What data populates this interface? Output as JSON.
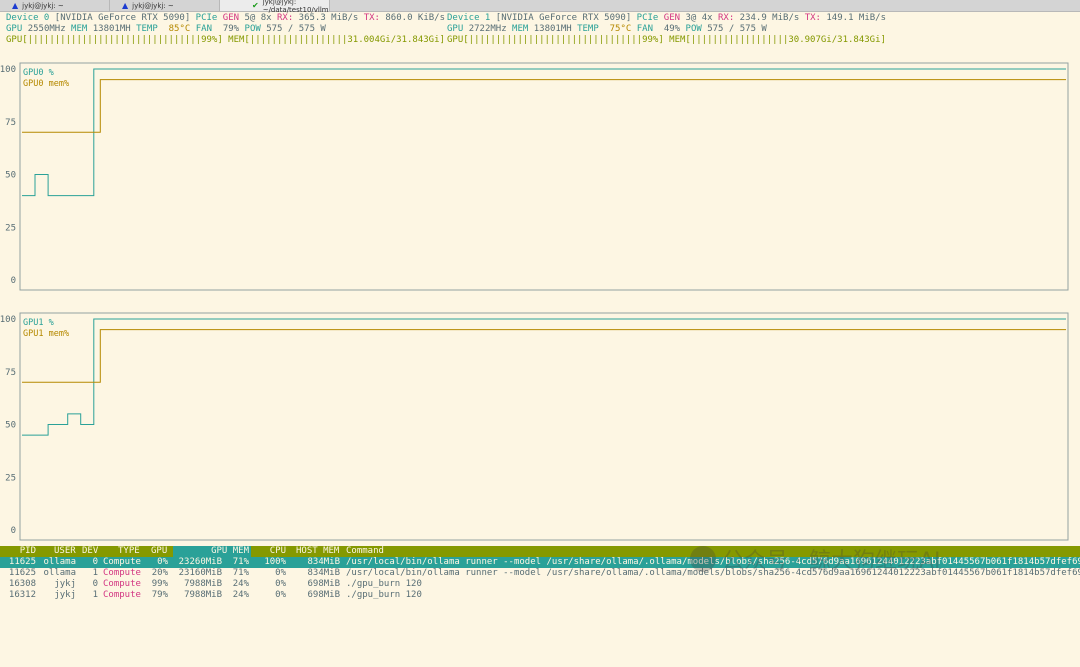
{
  "tabs": [
    {
      "label": "jykj@jykj: ~",
      "icon": "warning-icon",
      "active": false
    },
    {
      "label": "jykj@jykj: ~",
      "icon": "warning-icon",
      "active": false
    },
    {
      "label": "jykj@jykj: ~/data/test10/vllm",
      "icon": "check-icon",
      "active": true
    }
  ],
  "devices": [
    {
      "label": "Device 0",
      "name": "[NVIDIA GeForce RTX 5090]",
      "pcie_label": "PCIe",
      "gen_label": "GEN",
      "gen_value": "5@ 8x",
      "rx_label": "RX:",
      "rx_value": "365.3 MiB/s",
      "tx_label": "TX:",
      "tx_value": "860.0 KiB/s",
      "gpu_label": "GPU",
      "clock": "2550MHz",
      "mem_label": "MEM",
      "mem_clock": "13801MH",
      "temp_label": "TEMP",
      "temp": "85°C",
      "fan_label": "FAN",
      "fan": "79%",
      "pow_label": "POW",
      "pow": "575 / 575 W",
      "util_bar": "GPU[||||||||||||||||||||||||||||||||99%]",
      "mem_bar": "MEM[||||||||||||||||||31.004Gi/31.843Gi]"
    },
    {
      "label": "Device 1",
      "name": "[NVIDIA GeForce RTX 5090]",
      "pcie_label": "PCIe",
      "gen_label": "GEN",
      "gen_value": "3@ 4x",
      "rx_label": "RX:",
      "rx_value": "234.9 MiB/s",
      "tx_label": "TX:",
      "tx_value": "149.1 MiB/s",
      "gpu_label": "GPU",
      "clock": "2722MHz",
      "mem_label": "MEM",
      "mem_clock": "13801MH",
      "temp_label": "TEMP",
      "temp": "75°C",
      "fan_label": "FAN",
      "fan": "49%",
      "pow_label": "POW",
      "pow": "575 / 575 W",
      "util_bar": "GPU[||||||||||||||||||||||||||||||||99%]",
      "mem_bar": "MEM[||||||||||||||||||30.907Gi/31.843Gi]"
    }
  ],
  "chart_data": [
    {
      "type": "line",
      "ylim": [
        0,
        100
      ],
      "yticks": [
        100,
        75,
        50,
        25,
        0
      ],
      "x": [
        0,
        1,
        2,
        3,
        4,
        5,
        6,
        7,
        8,
        9,
        10,
        11,
        12,
        13,
        14,
        15,
        16,
        17,
        18,
        19,
        20,
        21,
        22,
        23,
        24,
        25,
        26,
        27,
        28,
        29,
        30,
        31,
        32,
        33,
        34,
        35,
        36,
        37,
        38,
        39,
        40,
        41,
        42,
        43,
        44,
        45,
        46,
        47,
        48,
        49,
        50,
        51,
        52,
        53,
        54,
        55,
        56,
        57,
        58,
        59,
        60,
        61,
        62,
        63,
        64,
        65,
        66,
        67,
        68,
        69,
        70,
        71,
        72,
        73,
        74,
        75,
        76,
        77,
        78,
        79,
        80,
        81,
        82,
        83,
        84,
        85,
        86,
        87,
        88,
        89,
        90,
        91,
        92,
        93,
        94,
        95,
        96,
        97,
        98,
        99,
        100,
        101,
        102,
        103,
        104,
        105,
        106,
        107,
        108,
        109,
        110,
        111,
        112,
        113,
        114,
        115,
        116,
        117,
        118,
        119,
        120,
        121,
        122,
        123,
        124,
        125,
        126,
        127,
        128,
        129,
        130,
        131,
        132,
        133,
        134,
        135,
        136,
        137,
        138,
        139,
        140,
        141,
        142,
        143,
        144,
        145,
        146,
        147,
        148,
        149,
        150,
        151,
        152,
        153,
        154,
        155,
        156,
        157,
        158,
        159
      ],
      "series": [
        {
          "name": "GPU0 %",
          "color": "#2aa198",
          "values": [
            40,
            40,
            50,
            50,
            40,
            40,
            40,
            40,
            40,
            40,
            40,
            100,
            100,
            100,
            100,
            100,
            100,
            100,
            100,
            100,
            100,
            100,
            100,
            100,
            100,
            100,
            100,
            100,
            100,
            100,
            100,
            100,
            100,
            100,
            100,
            100,
            100,
            100,
            100,
            100,
            100,
            100,
            100,
            100,
            100,
            100,
            100,
            100,
            100,
            100,
            100,
            100,
            100,
            100,
            100,
            100,
            100,
            100,
            100,
            100,
            100,
            100,
            100,
            100,
            100,
            100,
            100,
            100,
            100,
            100,
            100,
            100,
            100,
            100,
            100,
            100,
            100,
            100,
            100,
            100,
            100,
            100,
            100,
            100,
            100,
            100,
            100,
            100,
            100,
            100,
            100,
            100,
            100,
            100,
            100,
            100,
            100,
            100,
            100,
            100,
            100,
            100,
            100,
            100,
            100,
            100,
            100,
            100,
            100,
            100,
            100,
            100,
            100,
            100,
            100,
            100,
            100,
            100,
            100,
            100,
            100,
            100,
            100,
            100,
            100,
            100,
            100,
            100,
            100,
            100,
            100,
            100,
            100,
            100,
            100,
            100,
            100,
            100,
            100,
            100,
            100,
            100,
            100,
            100,
            100,
            100,
            100,
            100,
            100,
            100,
            100,
            100,
            100,
            100,
            100,
            100,
            100,
            100,
            100,
            100
          ]
        },
        {
          "name": "GPU0 mem%",
          "color": "#b58900",
          "values": [
            70,
            70,
            70,
            70,
            70,
            70,
            70,
            70,
            70,
            70,
            70,
            70,
            95,
            95,
            95,
            95,
            95,
            95,
            95,
            95,
            95,
            95,
            95,
            95,
            95,
            95,
            95,
            95,
            95,
            95,
            95,
            95,
            95,
            95,
            95,
            95,
            95,
            95,
            95,
            95,
            95,
            95,
            95,
            95,
            95,
            95,
            95,
            95,
            95,
            95,
            95,
            95,
            95,
            95,
            95,
            95,
            95,
            95,
            95,
            95,
            95,
            95,
            95,
            95,
            95,
            95,
            95,
            95,
            95,
            95,
            95,
            95,
            95,
            95,
            95,
            95,
            95,
            95,
            95,
            95,
            95,
            95,
            95,
            95,
            95,
            95,
            95,
            95,
            95,
            95,
            95,
            95,
            95,
            95,
            95,
            95,
            95,
            95,
            95,
            95,
            95,
            95,
            95,
            95,
            95,
            95,
            95,
            95,
            95,
            95,
            95,
            95,
            95,
            95,
            95,
            95,
            95,
            95,
            95,
            95,
            95,
            95,
            95,
            95,
            95,
            95,
            95,
            95,
            95,
            95,
            95,
            95,
            95,
            95,
            95,
            95,
            95,
            95,
            95,
            95,
            95,
            95,
            95,
            95,
            95,
            95,
            95,
            95,
            95,
            95,
            95,
            95,
            95,
            95,
            95,
            95,
            95,
            95,
            95,
            95
          ]
        }
      ]
    },
    {
      "type": "line",
      "ylim": [
        0,
        100
      ],
      "yticks": [
        100,
        75,
        50,
        25,
        0
      ],
      "x": [
        0,
        1,
        2,
        3,
        4,
        5,
        6,
        7,
        8,
        9,
        10,
        11,
        12,
        13,
        14,
        15,
        16,
        17,
        18,
        19,
        20,
        21,
        22,
        23,
        24,
        25,
        26,
        27,
        28,
        29,
        30,
        31,
        32,
        33,
        34,
        35,
        36,
        37,
        38,
        39,
        40,
        41,
        42,
        43,
        44,
        45,
        46,
        47,
        48,
        49,
        50,
        51,
        52,
        53,
        54,
        55,
        56,
        57,
        58,
        59,
        60,
        61,
        62,
        63,
        64,
        65,
        66,
        67,
        68,
        69,
        70,
        71,
        72,
        73,
        74,
        75,
        76,
        77,
        78,
        79,
        80,
        81,
        82,
        83,
        84,
        85,
        86,
        87,
        88,
        89,
        90,
        91,
        92,
        93,
        94,
        95,
        96,
        97,
        98,
        99,
        100,
        101,
        102,
        103,
        104,
        105,
        106,
        107,
        108,
        109,
        110,
        111,
        112,
        113,
        114,
        115,
        116,
        117,
        118,
        119,
        120,
        121,
        122,
        123,
        124,
        125,
        126,
        127,
        128,
        129,
        130,
        131,
        132,
        133,
        134,
        135,
        136,
        137,
        138,
        139,
        140,
        141,
        142,
        143,
        144,
        145,
        146,
        147,
        148,
        149,
        150,
        151,
        152,
        153,
        154,
        155,
        156,
        157,
        158,
        159
      ],
      "series": [
        {
          "name": "GPU1 %",
          "color": "#2aa198",
          "values": [
            45,
            45,
            45,
            45,
            50,
            50,
            50,
            55,
            55,
            50,
            50,
            100,
            100,
            100,
            100,
            100,
            100,
            100,
            100,
            100,
            100,
            100,
            100,
            100,
            100,
            100,
            100,
            100,
            100,
            100,
            100,
            100,
            100,
            100,
            100,
            100,
            100,
            100,
            100,
            100,
            100,
            100,
            100,
            100,
            100,
            100,
            100,
            100,
            100,
            100,
            100,
            100,
            100,
            100,
            100,
            100,
            100,
            100,
            100,
            100,
            100,
            100,
            100,
            100,
            100,
            100,
            100,
            100,
            100,
            100,
            100,
            100,
            100,
            100,
            100,
            100,
            100,
            100,
            100,
            100,
            100,
            100,
            100,
            100,
            100,
            100,
            100,
            100,
            100,
            100,
            100,
            100,
            100,
            100,
            100,
            100,
            100,
            100,
            100,
            100,
            100,
            100,
            100,
            100,
            100,
            100,
            100,
            100,
            100,
            100,
            100,
            100,
            100,
            100,
            100,
            100,
            100,
            100,
            100,
            100,
            100,
            100,
            100,
            100,
            100,
            100,
            100,
            100,
            100,
            100,
            100,
            100,
            100,
            100,
            100,
            100,
            100,
            100,
            100,
            100,
            100,
            100,
            100,
            100,
            100,
            100,
            100,
            100,
            100,
            100,
            100,
            100,
            100,
            100,
            100,
            100,
            100,
            100,
            100,
            100
          ]
        },
        {
          "name": "GPU1 mem%",
          "color": "#b58900",
          "values": [
            70,
            70,
            70,
            70,
            70,
            70,
            70,
            70,
            70,
            70,
            70,
            70,
            95,
            95,
            95,
            95,
            95,
            95,
            95,
            95,
            95,
            95,
            95,
            95,
            95,
            95,
            95,
            95,
            95,
            95,
            95,
            95,
            95,
            95,
            95,
            95,
            95,
            95,
            95,
            95,
            95,
            95,
            95,
            95,
            95,
            95,
            95,
            95,
            95,
            95,
            95,
            95,
            95,
            95,
            95,
            95,
            95,
            95,
            95,
            95,
            95,
            95,
            95,
            95,
            95,
            95,
            95,
            95,
            95,
            95,
            95,
            95,
            95,
            95,
            95,
            95,
            95,
            95,
            95,
            95,
            95,
            95,
            95,
            95,
            95,
            95,
            95,
            95,
            95,
            95,
            95,
            95,
            95,
            95,
            95,
            95,
            95,
            95,
            95,
            95,
            95,
            95,
            95,
            95,
            95,
            95,
            95,
            95,
            95,
            95,
            95,
            95,
            95,
            95,
            95,
            95,
            95,
            95,
            95,
            95,
            95,
            95,
            95,
            95,
            95,
            95,
            95,
            95,
            95,
            95,
            95,
            95,
            95,
            95,
            95,
            95,
            95,
            95,
            95,
            95,
            95,
            95,
            95,
            95,
            95,
            95,
            95,
            95,
            95,
            95,
            95,
            95,
            95,
            95,
            95,
            95,
            95,
            95,
            95,
            95
          ]
        }
      ]
    }
  ],
  "process_table": {
    "headers": [
      "PID",
      "USER",
      "DEV",
      "TYPE",
      "GPU",
      "GPU MEM",
      "CPU",
      "HOST MEM",
      "Command"
    ],
    "rows": [
      {
        "pid": "11625",
        "user": "ollama",
        "dev": "0",
        "type": "Compute",
        "gpu": "0%",
        "gpu_mem": "23260MiB",
        "gpu_mem_pct": "71%",
        "cpu": "100%",
        "host_mem": "834MiB",
        "command": "/usr/local/bin/ollama runner --model /usr/share/ollama/.ollama/models/blobs/sha256-4cd576d9aa16961244012223abf01445567b061f1814b57dfef699",
        "selected": true
      },
      {
        "pid": "11625",
        "user": "ollama",
        "dev": "1",
        "type": "Compute",
        "gpu": "20%",
        "gpu_mem": "23160MiB",
        "gpu_mem_pct": "71%",
        "cpu": "0%",
        "host_mem": "834MiB",
        "command": "/usr/local/bin/ollama runner --model /usr/share/ollama/.ollama/models/blobs/sha256-4cd576d9aa16961244012223abf01445567b061f1814b57dfef69",
        "selected": false
      },
      {
        "pid": "16308",
        "user": "jykj",
        "dev": "0",
        "type": "Compute",
        "gpu": "99%",
        "gpu_mem": "7988MiB",
        "gpu_mem_pct": "24%",
        "cpu": "0%",
        "host_mem": "698MiB",
        "command": "./gpu_burn 120",
        "selected": false
      },
      {
        "pid": "16312",
        "user": "jykj",
        "dev": "1",
        "type": "Compute",
        "gpu": "79%",
        "gpu_mem": "7988MiB",
        "gpu_mem_pct": "24%",
        "cpu": "0%",
        "host_mem": "698MiB",
        "command": "./gpu_burn 120",
        "selected": false
      }
    ]
  },
  "watermark": "公众号 · 鲸大狗继玩AI"
}
